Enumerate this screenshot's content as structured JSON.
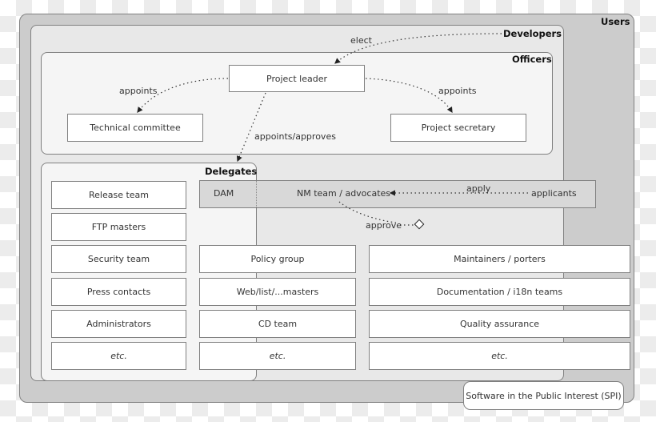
{
  "groups": {
    "users": "Users",
    "developers": "Developers",
    "officers": "Officers",
    "delegates": "Delegates"
  },
  "officers": {
    "project_leader": "Project leader",
    "technical_committee": "Technical committee",
    "project_secretary": "Project secretary"
  },
  "relations": {
    "elect": "elect",
    "appoints_left": "appoints",
    "appoints_right": "appoints",
    "appoints_approves": "appoints/approves",
    "apply": "apply",
    "approve": "approve"
  },
  "nm_bar": {
    "dam": "DAM",
    "nm_team": "NM team / advocates",
    "applicants": "applicants"
  },
  "delegate_teams": [
    "Release team",
    "FTP masters",
    "Security team",
    "Press contacts",
    "Administrators",
    "etc."
  ],
  "middle_teams": [
    "Policy group",
    "Web/list/...masters",
    "CD team",
    "etc."
  ],
  "right_teams": [
    "Maintainers / porters",
    "Documentation / i18n teams",
    "Quality assurance",
    "etc."
  ],
  "spi": "Software in the Public Interest (SPI)"
}
